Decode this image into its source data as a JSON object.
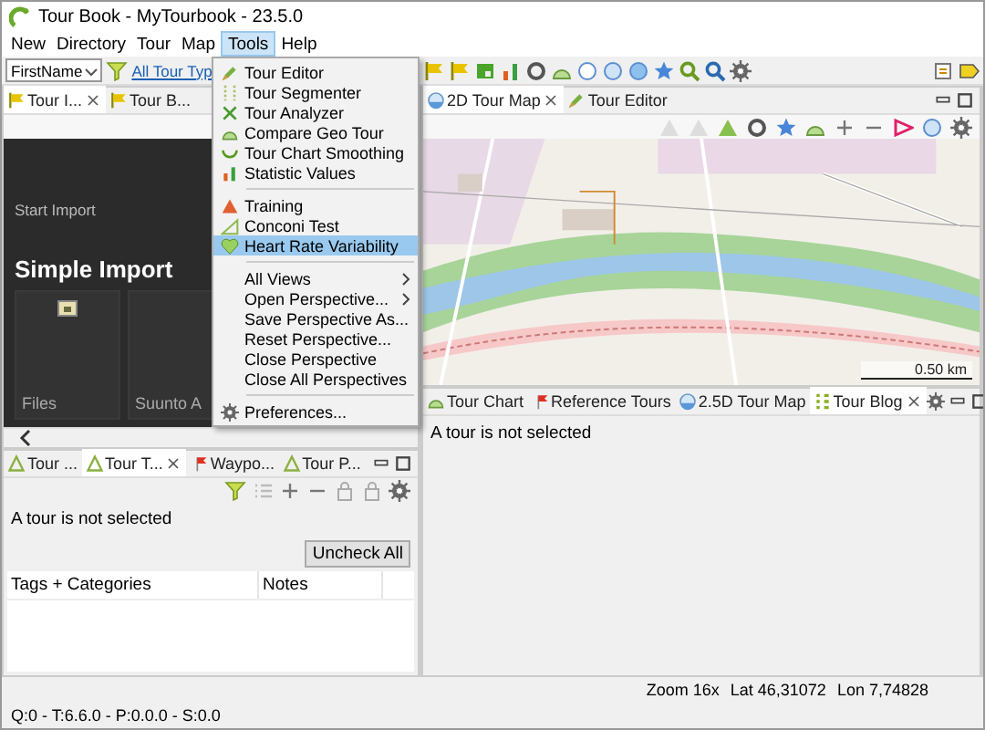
{
  "window": {
    "title": "Tour Book - MyTourbook - 23.5.0"
  },
  "menu_bar": [
    {
      "label": "New",
      "selected": false
    },
    {
      "label": "Directory",
      "selected": false
    },
    {
      "label": "Tour",
      "selected": false
    },
    {
      "label": "Map",
      "selected": false
    },
    {
      "label": "Tools",
      "selected": true
    },
    {
      "label": "Help",
      "selected": false
    }
  ],
  "toolbar": {
    "person_combo": "FirstName",
    "tour_type_link": "All Tour Typ"
  },
  "tools_menu": [
    {
      "kind": "item",
      "label": "Tour Editor",
      "selected": false
    },
    {
      "kind": "item",
      "label": "Tour Segmenter",
      "selected": false
    },
    {
      "kind": "item",
      "label": "Tour Analyzer",
      "selected": false
    },
    {
      "kind": "item",
      "label": "Compare Geo Tour",
      "selected": false
    },
    {
      "kind": "item",
      "label": "Tour Chart Smoothing",
      "selected": false
    },
    {
      "kind": "item",
      "label": "Statistic Values",
      "selected": false
    },
    {
      "kind": "separator"
    },
    {
      "kind": "item",
      "label": "Training",
      "selected": false
    },
    {
      "kind": "item",
      "label": "Conconi Test",
      "selected": false
    },
    {
      "kind": "item",
      "label": "Heart Rate Variability",
      "selected": true
    },
    {
      "kind": "separator"
    },
    {
      "kind": "submenu",
      "label": "All Views",
      "selected": false
    },
    {
      "kind": "submenu",
      "label": "Open Perspective...",
      "selected": false
    },
    {
      "kind": "item",
      "label": "Save Perspective As...",
      "selected": false
    },
    {
      "kind": "item",
      "label": "Reset Perspective...",
      "selected": false
    },
    {
      "kind": "item",
      "label": "Close Perspective",
      "selected": false
    },
    {
      "kind": "item",
      "label": "Close All Perspectives",
      "selected": false
    },
    {
      "kind": "separator"
    },
    {
      "kind": "item",
      "label": "Preferences...",
      "selected": false
    }
  ],
  "left_top": {
    "tabs": [
      {
        "label": "Tour I...",
        "selected": true
      },
      {
        "label": "Tour B...",
        "selected": false
      }
    ],
    "section_label": "Start Import",
    "title": "Simple Import",
    "tiles": [
      "Files",
      "Suunto A"
    ]
  },
  "left_bottom": {
    "tabs": [
      {
        "label": "Tour ...",
        "selected": false
      },
      {
        "label": "Tour T...",
        "selected": true
      },
      {
        "label": "Waypo...",
        "selected": false
      },
      {
        "label": "Tour P...",
        "selected": false
      }
    ],
    "message": "A tour is not selected",
    "uncheck_button": "Uncheck All",
    "columns": [
      "Tags + Categories",
      "Notes"
    ]
  },
  "right_top": {
    "tabs": [
      {
        "label": "2D Tour Map",
        "selected": true
      },
      {
        "label": "Tour Editor",
        "selected": false
      }
    ],
    "scale": "0.50 km"
  },
  "right_bottom": {
    "tabs": [
      {
        "label": "Tour Chart",
        "selected": false
      },
      {
        "label": "Reference Tours",
        "selected": false
      },
      {
        "label": "2.5D Tour Map",
        "selected": false
      },
      {
        "label": "Tour Blog",
        "selected": true
      }
    ],
    "message": "A tour is not selected"
  },
  "status_bar": {
    "map_info": [
      "Zoom 16x",
      "Lat 46,31072",
      "Lon 7,74828"
    ],
    "tour_info": "Q:0 - T:6.6.0 - P:0.0.0 - S:0.0"
  }
}
